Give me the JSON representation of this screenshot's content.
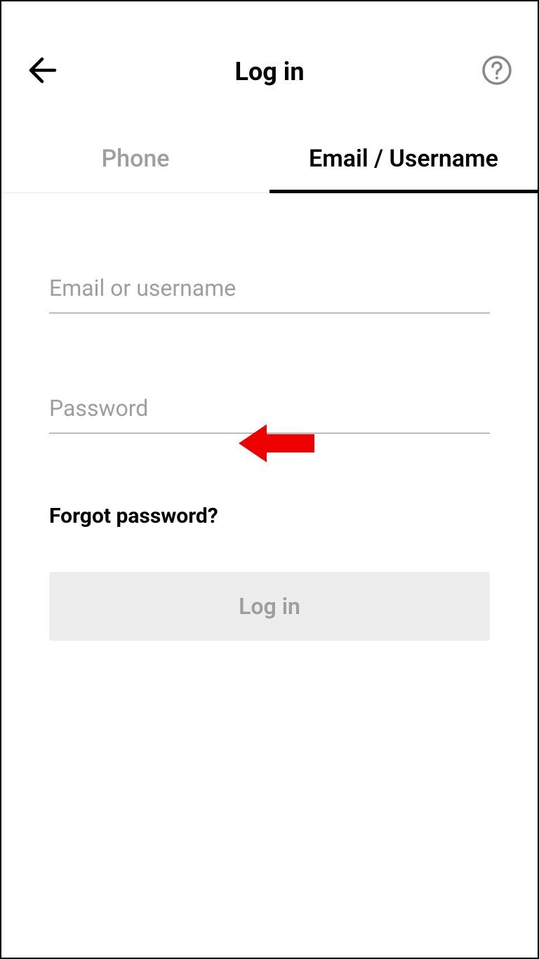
{
  "header": {
    "title": "Log in"
  },
  "tabs": {
    "phone": "Phone",
    "email": "Email / Username"
  },
  "form": {
    "email_placeholder": "Email or username",
    "password_placeholder": "Password",
    "forgot_password": "Forgot password?",
    "login_button": "Log in"
  }
}
